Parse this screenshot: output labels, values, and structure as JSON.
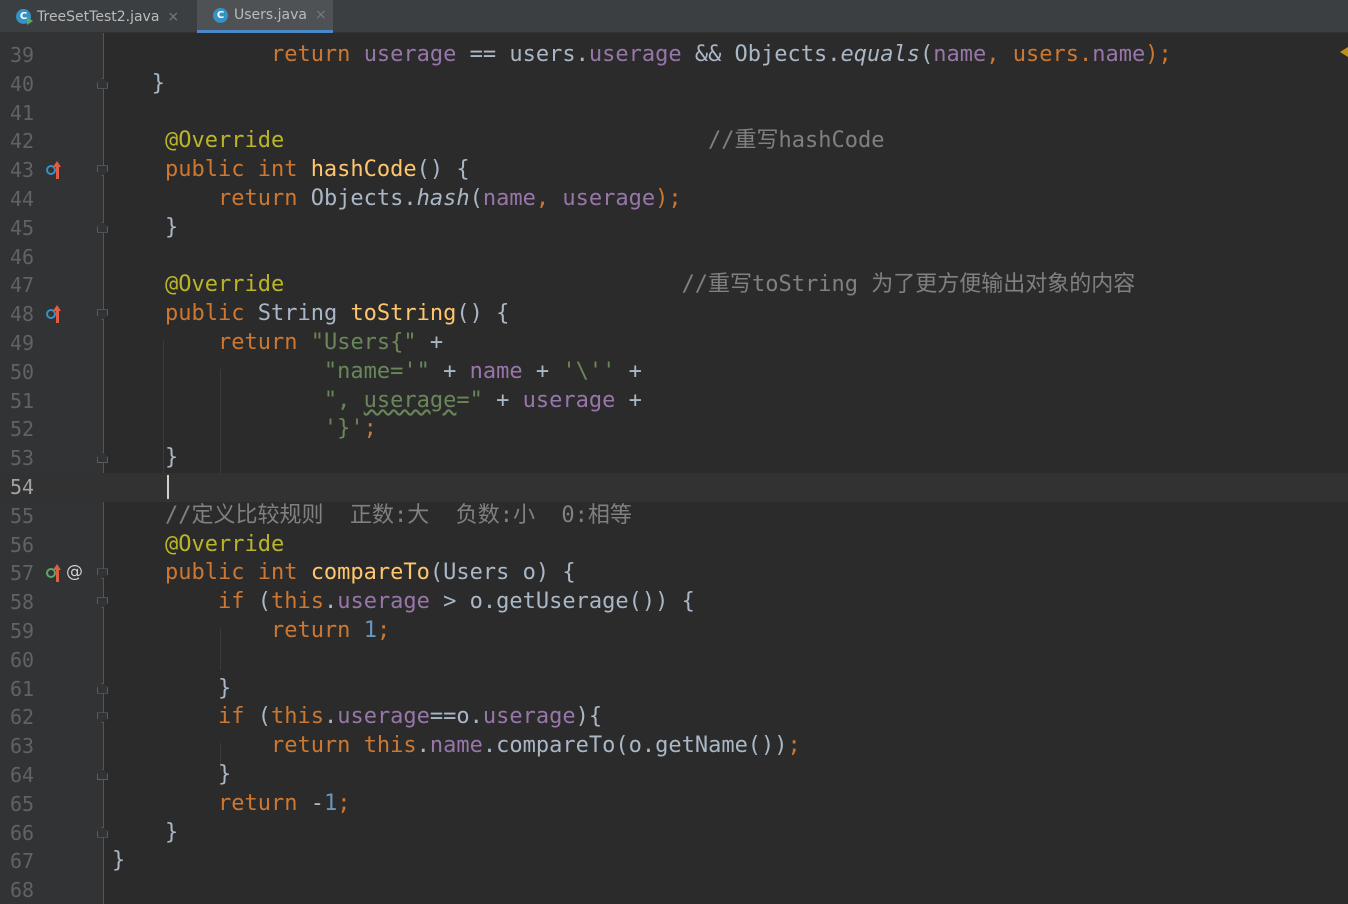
{
  "tabs": [
    {
      "label": "TreeSetTest2.java",
      "active": false,
      "icon": "java-class-runnable-icon"
    },
    {
      "label": "Users.java",
      "active": true,
      "icon": "java-class-icon"
    }
  ],
  "tab_close_glyph": "×",
  "editor": {
    "lines": [
      {
        "n": "39"
      },
      {
        "n": "40"
      },
      {
        "n": "41"
      },
      {
        "n": "42"
      },
      {
        "n": "43"
      },
      {
        "n": "44"
      },
      {
        "n": "45"
      },
      {
        "n": "46"
      },
      {
        "n": "47"
      },
      {
        "n": "48"
      },
      {
        "n": "49"
      },
      {
        "n": "50"
      },
      {
        "n": "51"
      },
      {
        "n": "52"
      },
      {
        "n": "53"
      },
      {
        "n": "54"
      },
      {
        "n": "55"
      },
      {
        "n": "56"
      },
      {
        "n": "57"
      },
      {
        "n": "58"
      },
      {
        "n": "59"
      },
      {
        "n": "60"
      },
      {
        "n": "61"
      },
      {
        "n": "62"
      },
      {
        "n": "63"
      },
      {
        "n": "64"
      },
      {
        "n": "65"
      },
      {
        "n": "66"
      },
      {
        "n": "67"
      },
      {
        "n": "68"
      }
    ],
    "current_line": "54",
    "code": {
      "l39": {
        "t1": "return",
        "t2": " ",
        "t3": "userage",
        "t4": " == users.",
        "t5": "userage",
        "t6": " && Objects.",
        "t7": "equals",
        "t8": "(",
        "t9": "name",
        "t10": ", users.",
        "t11": "name",
        "t12": ");"
      },
      "l40": {
        "t1": "}"
      },
      "l42": {
        "t1": "@Override",
        "t2": "//重写hashCode"
      },
      "l43": {
        "t1": "public int",
        "t2": " ",
        "t3": "hashCode",
        "t4": "() {"
      },
      "l44": {
        "t1": "return",
        "t2": " Objects.",
        "t3": "hash",
        "t4": "(",
        "t5": "name",
        "t6": ", ",
        "t7": "userage",
        "t8": ");"
      },
      "l45": {
        "t1": "}"
      },
      "l47": {
        "t1": "@Override",
        "t2": "//重写toString 为了更方便输出对象的内容"
      },
      "l48": {
        "t1": "public",
        "t2": " String ",
        "t3": "toString",
        "t4": "() {"
      },
      "l49": {
        "t1": "return",
        "t2": " ",
        "t3": "\"Users{\"",
        "t4": " +"
      },
      "l50": {
        "t1": "\"name='\"",
        "t2": " + ",
        "t3": "name",
        "t4": " + ",
        "t5": "'\\''",
        "t6": " +"
      },
      "l51": {
        "t1": "\", ",
        "t2": "userage",
        "t3": "=\"",
        "t4": " + ",
        "t5": "userage",
        "t6": " +"
      },
      "l52": {
        "t1": "'}'",
        "t2": ";"
      },
      "l53": {
        "t1": "}"
      },
      "l55": {
        "t1": "//定义比较规则  正数:大  负数:小  0:相等"
      },
      "l56": {
        "t1": "@Override"
      },
      "l57": {
        "t1": "public int",
        "t2": " ",
        "t3": "compareTo",
        "t4": "(Users o) {"
      },
      "l58": {
        "t1": "if",
        "t2": " (",
        "t3": "this",
        "t4": ".",
        "t5": "userage",
        "t6": " > o.getUserage()) {"
      },
      "l59": {
        "t1": "return",
        "t2": " ",
        "t3": "1",
        "t4": ";"
      },
      "l61": {
        "t1": "}"
      },
      "l62": {
        "t1": "if",
        "t2": " (",
        "t3": "this",
        "t4": ".",
        "t5": "userage",
        "t6": "==o.",
        "t7": "userage",
        "t8": "){"
      },
      "l63": {
        "t1": "return",
        "t2": " ",
        "t3": "this",
        "t4": ".",
        "t5": "name",
        "t6": ".compareTo(o.getName())",
        "t7": ";"
      },
      "l64": {
        "t1": "}"
      },
      "l65": {
        "t1": "return",
        "t2": " -",
        "t3": "1",
        "t4": ";"
      },
      "l66": {
        "t1": "}"
      },
      "l67": {
        "t1": "}"
      }
    }
  },
  "colors": {
    "background": "#2b2b2b",
    "gutter": "#313335",
    "keyword": "#cc7832",
    "field": "#9876aa",
    "annotation": "#bbb529",
    "string": "#6a8759",
    "number": "#6897bb",
    "method": "#ffc66d",
    "comment": "#808080",
    "text": "#a9b7c6"
  },
  "gutter_icons": {
    "l43": "override-method-icon",
    "l48": "override-method-icon",
    "l57": "implements-method-icon"
  }
}
